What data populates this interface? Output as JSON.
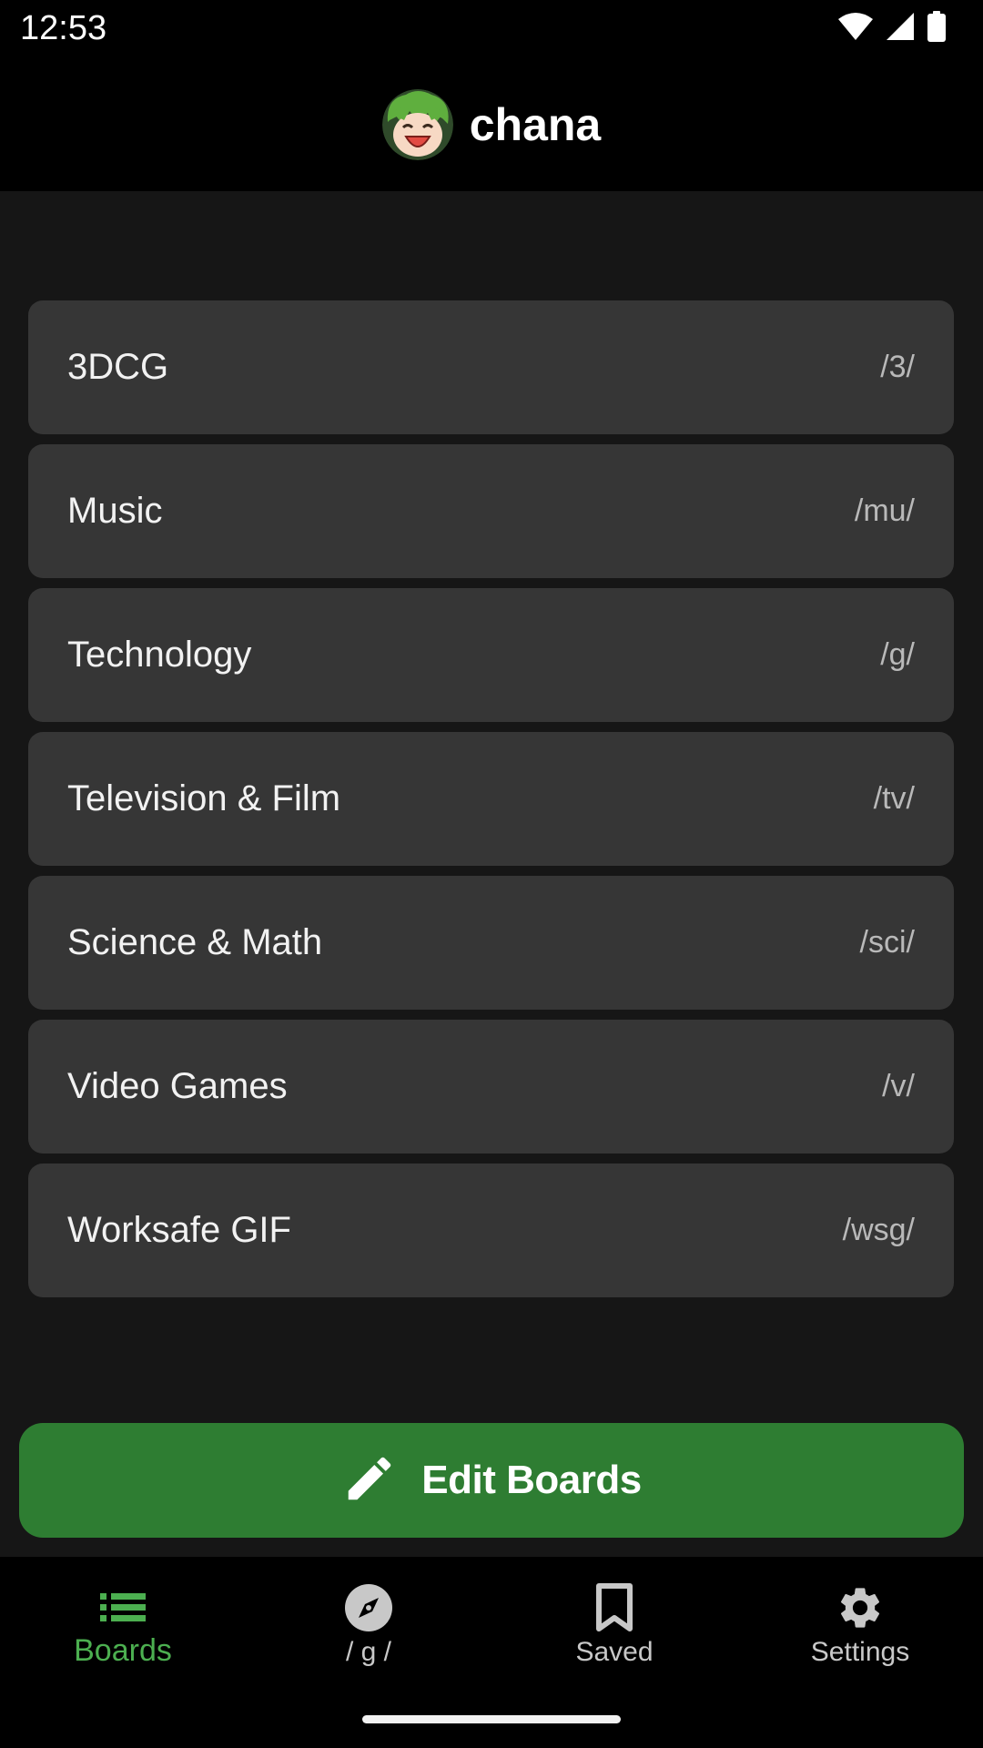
{
  "status_bar": {
    "time": "12:53",
    "icons": [
      "wifi-icon",
      "signal-icon",
      "battery-icon"
    ]
  },
  "header": {
    "avatar": "avatar-icon",
    "title": "chana"
  },
  "boards": [
    {
      "name": "3DCG",
      "code": "/3/"
    },
    {
      "name": "Music",
      "code": "/mu/"
    },
    {
      "name": "Technology",
      "code": "/g/"
    },
    {
      "name": "Television & Film",
      "code": "/tv/"
    },
    {
      "name": "Science & Math",
      "code": "/sci/"
    },
    {
      "name": "Video Games",
      "code": "/v/"
    },
    {
      "name": "Worksafe GIF",
      "code": "/wsg/"
    }
  ],
  "edit_button": {
    "icon": "pencil-icon",
    "label": "Edit Boards"
  },
  "bottom_nav": {
    "items": [
      {
        "label": "Boards",
        "icon": "list-icon",
        "active": true
      },
      {
        "label": "/ g /",
        "icon": "compass-icon",
        "active": false
      },
      {
        "label": "Saved",
        "icon": "bookmark-icon",
        "active": false
      },
      {
        "label": "Settings",
        "icon": "gear-icon",
        "active": false
      }
    ]
  },
  "colors": {
    "accent": "#4caf50",
    "button": "#2e7d32",
    "background": "#161616",
    "card": "#363636",
    "bar": "#000000"
  }
}
